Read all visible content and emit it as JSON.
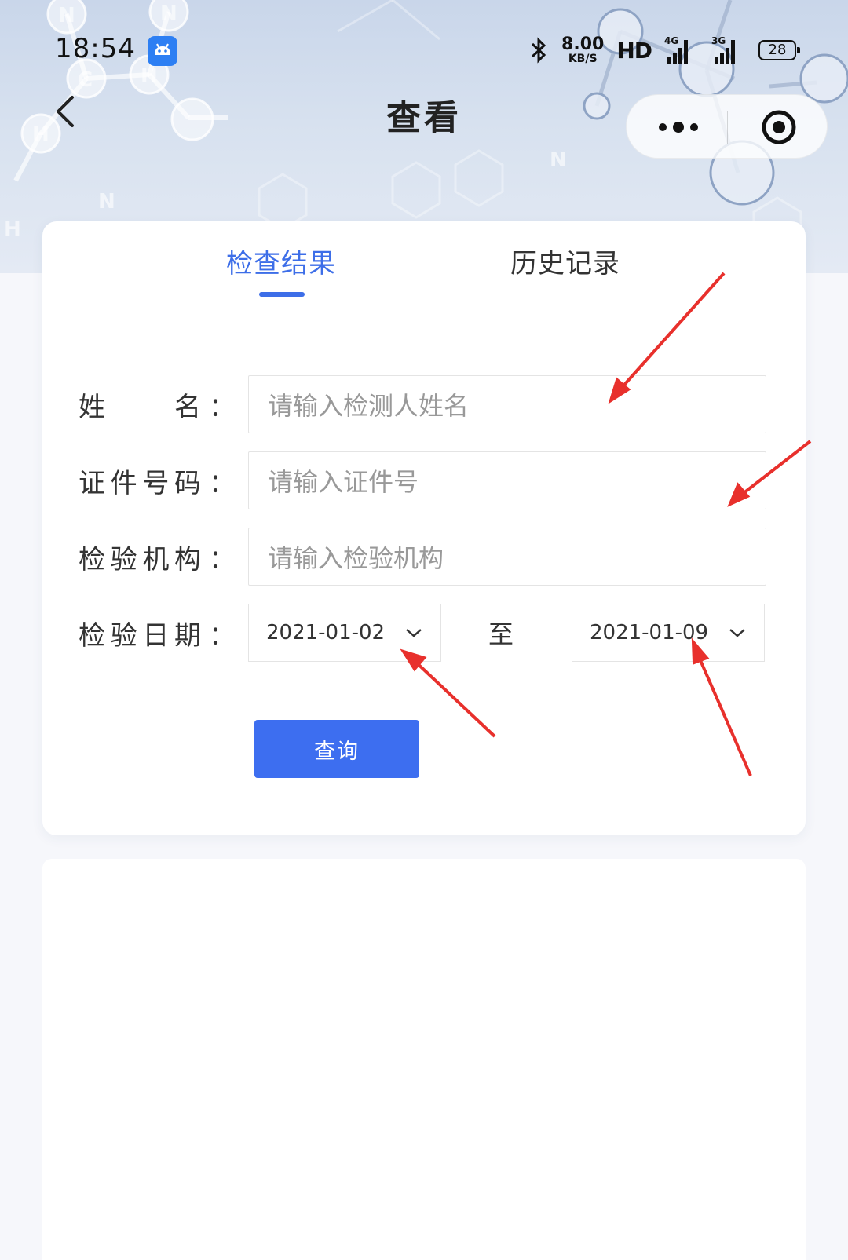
{
  "status_bar": {
    "time": "18:54",
    "speed_value": "8.00",
    "speed_unit": "KB/S",
    "hd_label": "HD",
    "signal_1_label": "4G",
    "signal_2_label": "3G",
    "battery_level": "28",
    "icons": [
      "android-app-icon",
      "bluetooth-icon",
      "signal-icon",
      "battery-icon"
    ]
  },
  "nav": {
    "title": "查看",
    "icons": [
      "back-icon",
      "more-icon",
      "close-icon"
    ]
  },
  "tabs": [
    {
      "label": "检查结果",
      "active": true
    },
    {
      "label": "历史记录",
      "active": false
    }
  ],
  "form": {
    "name": {
      "label_chars": [
        "姓",
        "名"
      ],
      "colon": "：",
      "placeholder": "请输入检测人姓名",
      "value": ""
    },
    "id_number": {
      "label_chars": [
        "证",
        "件",
        "号",
        "码"
      ],
      "colon": "：",
      "placeholder": "请输入证件号",
      "value": ""
    },
    "institution": {
      "label_chars": [
        "检",
        "验",
        "机",
        "构"
      ],
      "colon": "：",
      "placeholder": "请输入检验机构",
      "value": ""
    },
    "date": {
      "label_chars": [
        "检",
        "验",
        "日",
        "期"
      ],
      "colon": "：",
      "start": "2021-01-02",
      "to_label": "至",
      "end": "2021-01-09"
    }
  },
  "query_button": {
    "label": "查询"
  },
  "colors": {
    "accent": "#3d6ee8",
    "button": "#3d6ef0",
    "annotation_arrow": "#e8302c",
    "page_bg": "#f6f7fb"
  }
}
